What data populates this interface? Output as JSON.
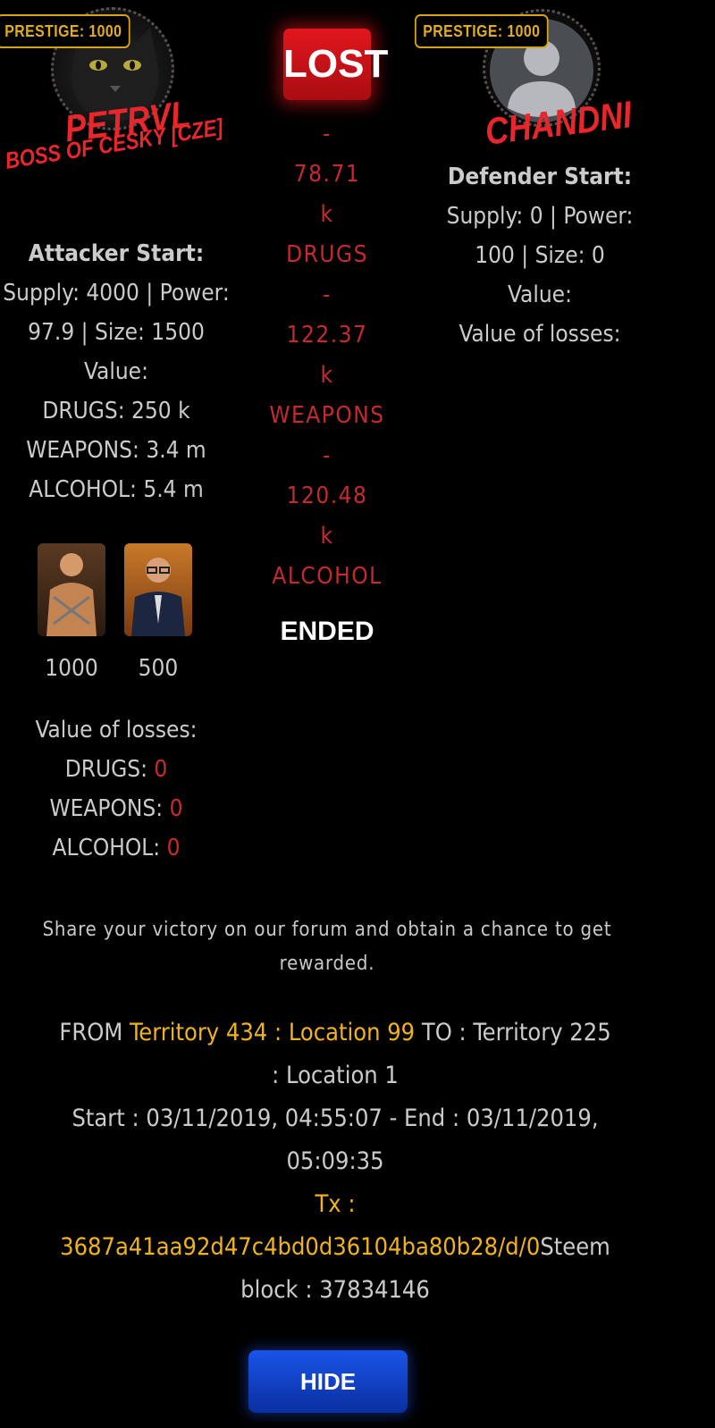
{
  "attacker": {
    "prestige": "PRESTIGE: 1000",
    "name": "PETRVL",
    "title": "BOSS OF CESKY [CZE]",
    "heading": "Attacker Start:",
    "stats_line1": "Supply: 4000 | Power:",
    "stats_line2": "97.9 | Size: 1500",
    "value_label": "Value:",
    "values": [
      "DRUGS: 250 k",
      "WEAPONS: 3.4 m",
      "ALCOHOL: 5.4 m"
    ],
    "units": [
      {
        "icon": "muscle-man-unit-icon",
        "count": "1000"
      },
      {
        "icon": "businessman-unit-icon",
        "count": "500"
      }
    ],
    "losses_label": "Value of losses:",
    "losses": [
      {
        "label": "DRUGS:",
        "value": "0"
      },
      {
        "label": "WEAPONS:",
        "value": "0"
      },
      {
        "label": "ALCOHOL:",
        "value": "0"
      }
    ]
  },
  "battle": {
    "result": "LOST",
    "lines": [
      "-",
      "78.71",
      "k",
      "DRUGS",
      "-",
      "122.37",
      "k",
      "WEAPONS",
      "-",
      "120.48",
      "k",
      "ALCOHOL"
    ],
    "status": "ENDED"
  },
  "defender": {
    "prestige": "PRESTIGE: 1000",
    "name": "CHANDNI",
    "heading": "Defender Start:",
    "stats_line1": "Supply: 0 | Power:",
    "stats_line2": "100 | Size: 0",
    "value_label": "Value:",
    "losses_label": "Value of losses:"
  },
  "footer": {
    "share_line1": "Share your victory on our forum and obtain a chance to get",
    "share_line2": "rewarded.",
    "from_prefix": "FROM",
    "from_location": "Territory 434 : Location 99",
    "to_text": "TO : Territory 225",
    "to_line2": ": Location 1",
    "time_line1": "Start : 03/11/2019, 04:55:07 - End : 03/11/2019,",
    "time_line2": "05:09:35",
    "tx_label": "Tx :",
    "tx_hash": "3687a41aa92d47c4bd0d36104ba80b28/d/0",
    "steem_text": "Steem",
    "block_text": "block : 37834146",
    "hide_button": "HIDE"
  },
  "colors": {
    "background": "#000000",
    "accent_red": "#e8262b",
    "gold": "#f0b31a",
    "button_blue": "#1a54e8"
  }
}
